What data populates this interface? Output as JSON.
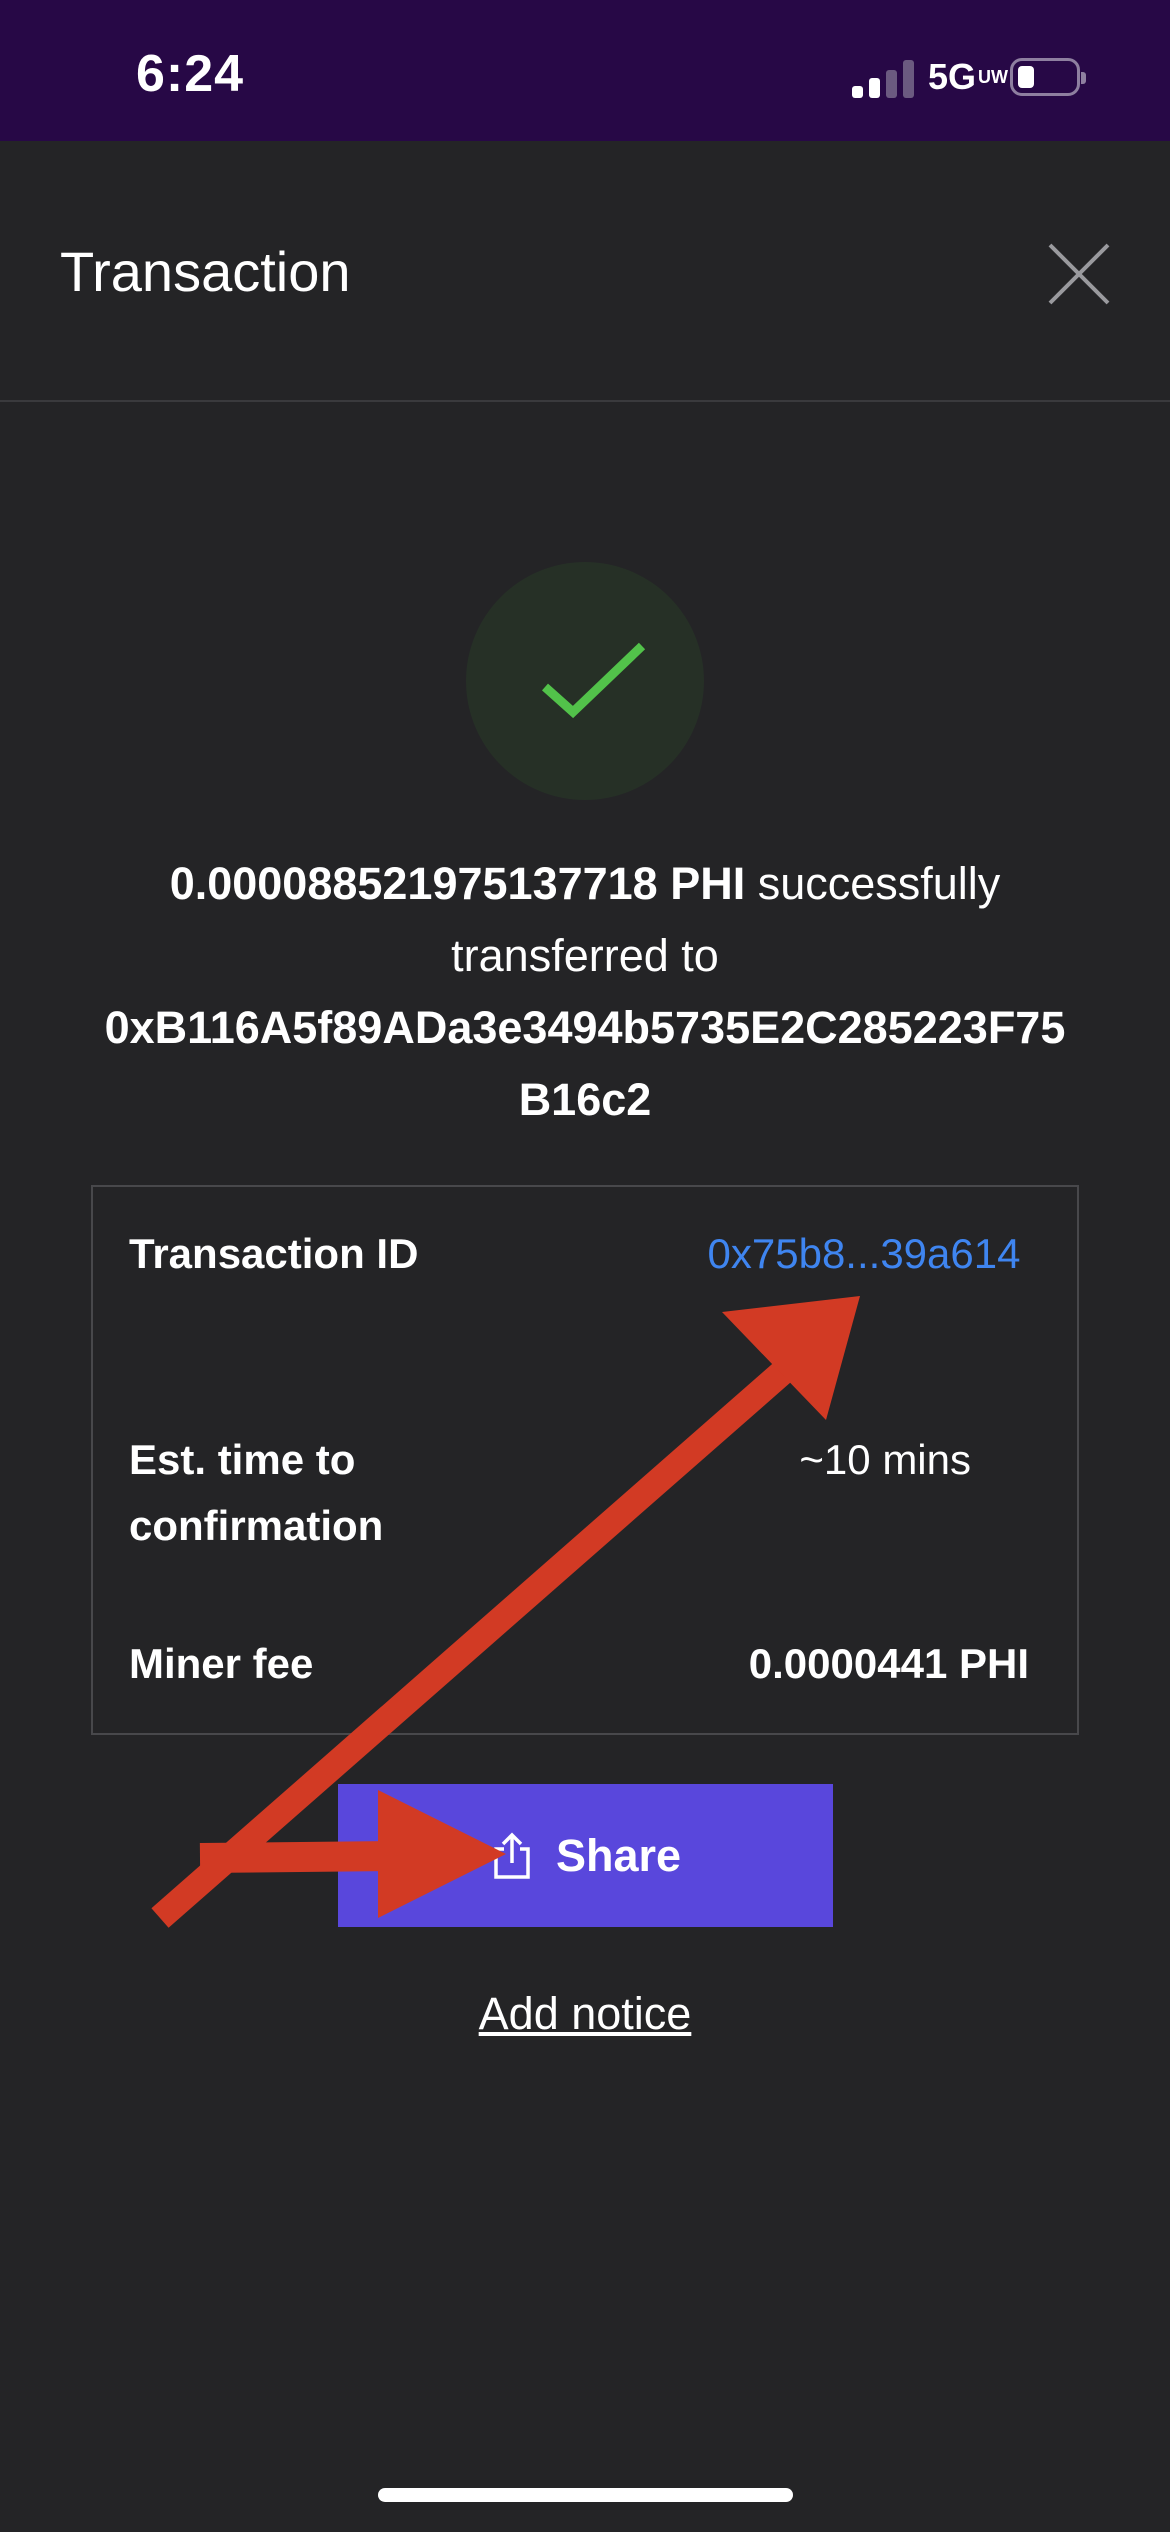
{
  "status_bar": {
    "time": "6:24",
    "network": "5G",
    "network_suffix": "UW"
  },
  "header": {
    "title": "Transaction",
    "close_icon": "close-icon"
  },
  "success": {
    "icon": "checkmark-icon",
    "accent_color": "#52c24a"
  },
  "message": {
    "amount": "0.000088521975137718 PHI",
    "text_middle": " successfully transferred to ",
    "address": "0xB116A5f89ADa3e3494b5735E2C285223F75B16c2"
  },
  "details": {
    "transaction_id_label": "Transaction ID",
    "transaction_id_value": "0x75b8...39a614",
    "est_time_label": "Est. time to confirmation",
    "est_time_value": "~10 mins",
    "miner_fee_label": "Miner fee",
    "miner_fee_value": "0.0000441 PHI"
  },
  "actions": {
    "share_label": "Share",
    "share_icon": "share-icon",
    "add_notice_label": "Add notice"
  },
  "colors": {
    "background": "#242426",
    "status_bar": "#270846",
    "primary_button": "#5947dc",
    "link": "#3f85f0",
    "annotation_arrow": "#d23a24"
  }
}
